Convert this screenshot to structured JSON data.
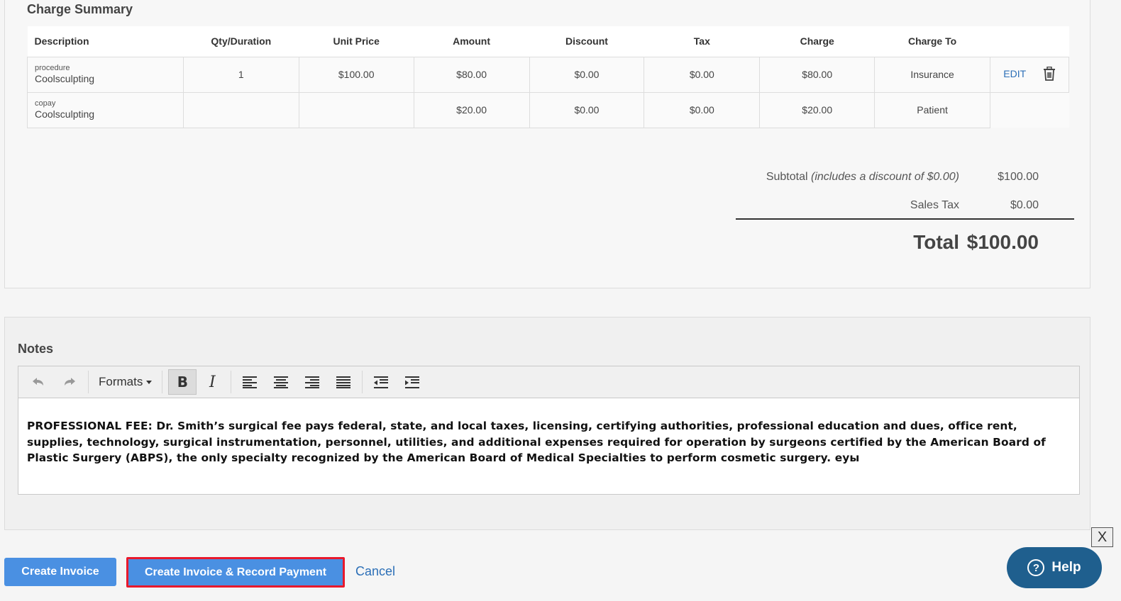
{
  "charge_summary": {
    "title": "Charge Summary",
    "columns": [
      "Description",
      "Qty/Duration",
      "Unit Price",
      "Amount",
      "Discount",
      "Tax",
      "Charge",
      "Charge To"
    ],
    "rows": [
      {
        "type": "procedure",
        "name": "Coolsculpting",
        "qty": "1",
        "unit_price": "$100.00",
        "amount": "$80.00",
        "discount": "$0.00",
        "tax": "$0.00",
        "charge": "$80.00",
        "charge_to": "Insurance",
        "edit_label": "EDIT"
      },
      {
        "type": "copay",
        "name": "Coolsculpting",
        "qty": "",
        "unit_price": "",
        "amount": "$20.00",
        "discount": "$0.00",
        "tax": "$0.00",
        "charge": "$20.00",
        "charge_to": "Patient"
      }
    ],
    "totals": {
      "subtotal_label": "Subtotal",
      "subtotal_note": "(includes a discount of $0.00)",
      "subtotal_value": "$100.00",
      "sales_tax_label": "Sales Tax",
      "sales_tax_value": "$0.00",
      "total_label": "Total",
      "total_value": "$100.00"
    }
  },
  "notes": {
    "title": "Notes",
    "toolbar": {
      "formats_label": "Formats",
      "bold_label": "B",
      "italic_label": "I"
    },
    "content": "PROFESSIONAL FEE: Dr. Smith’s surgical fee pays federal, state, and local taxes, licensing, certifying authorities, professional education and dues, office rent, supplies, technology, surgical instrumentation, personnel, utilities, and additional expenses required for operation by surgeons certified by the American Board of Plastic Surgery (ABPS), the only specialty recognized by the American Board of Medical Specialties to perform cosmetic surgery. еуы"
  },
  "actions": {
    "create_invoice": "Create Invoice",
    "create_invoice_record_payment": "Create Invoice & Record Payment",
    "cancel": "Cancel",
    "close": "X",
    "help": "Help",
    "help_icon_glyph": "?"
  },
  "colors": {
    "primary_button": "#4a90e2",
    "highlight_outline": "#e8192c",
    "help_button": "#1f5f8e",
    "link": "#2c6fb7"
  }
}
